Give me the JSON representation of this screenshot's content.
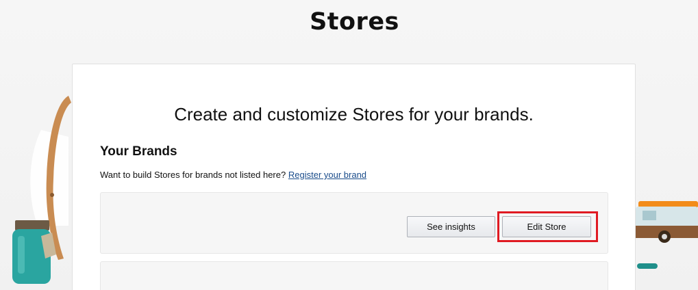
{
  "page": {
    "title": "Stores"
  },
  "card": {
    "headline": "Create and customize Stores for your brands.",
    "section_title": "Your Brands",
    "helper_text": "Want to build Stores for brands not listed here?",
    "register_link": "Register your brand"
  },
  "brand_row": {
    "see_insights_label": "See insights",
    "edit_store_label": "Edit Store"
  },
  "colors": {
    "highlight": "#e01a22",
    "link": "#1a4c8b"
  }
}
